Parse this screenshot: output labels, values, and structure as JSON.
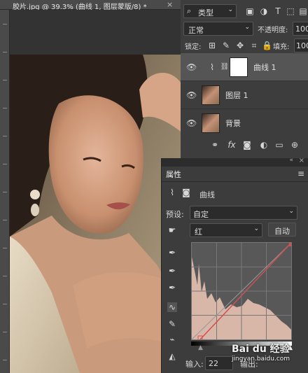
{
  "document": {
    "tab_title": "胶片.jpg @ 39.3% (曲线 1, 图层蒙版/8) *",
    "close_glyph": "×"
  },
  "layers_panel": {
    "filter_kind": "类型",
    "blend_mode": "正常",
    "opacity_label": "不透明度:",
    "opacity_value": "100",
    "lock_label": "锁定:",
    "fill_label": "填充:",
    "fill_value": "100",
    "layers": [
      {
        "name": "曲线 1",
        "type": "adjustment",
        "active": true
      },
      {
        "name": "图层 1",
        "type": "pixel",
        "active": false
      },
      {
        "name": "背景",
        "type": "pixel",
        "active": false
      }
    ]
  },
  "properties_panel": {
    "tab_label": "属性",
    "adjustment_title": "曲线",
    "preset_label": "预设:",
    "preset_value": "自定",
    "channel_value": "红",
    "auto_button": "自动",
    "input_label": "输入:",
    "input_value": "22",
    "output_label_partial": "输出:",
    "watermark_text": "Bai du 经验",
    "watermark_sub": "jingyan.baidu.com"
  },
  "colors": {
    "panel_bg": "#3c3c3c",
    "active_layer": "#555555",
    "curve_line": "#d05050",
    "histogram_fill": "#d8b6a8"
  }
}
